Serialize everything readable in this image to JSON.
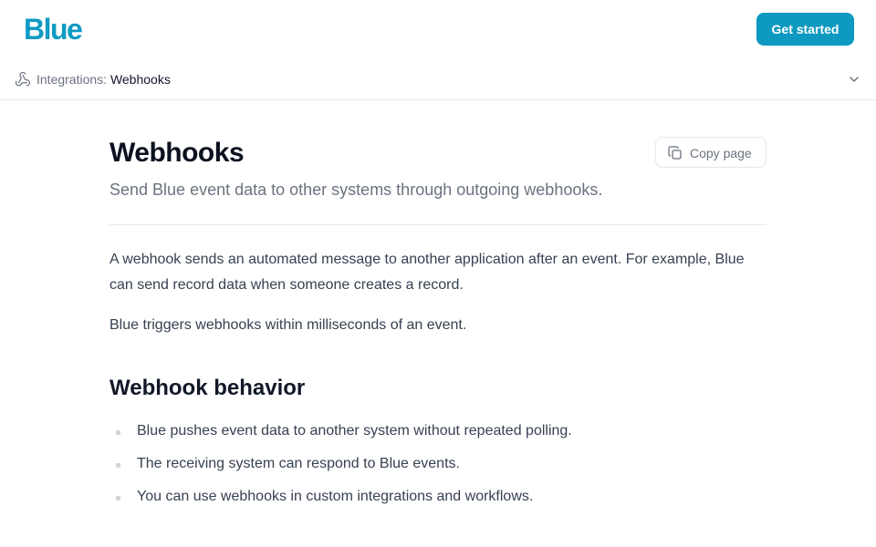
{
  "header": {
    "logo_text": "Blue",
    "cta_label": "Get started",
    "brand_color": "#0e99c0"
  },
  "breadcrumb": {
    "icon": "webhook-icon",
    "section": "Integrations: ",
    "current": "Webhooks",
    "toggle_icon": "chevron-down-icon"
  },
  "article": {
    "title": "Webhooks",
    "copy_button_label": "Copy page",
    "copy_icon": "copy-icon",
    "subtitle": "Send Blue event data to other systems through outgoing webhooks.",
    "paragraphs": [
      "A webhook sends an automated message to another application after an event. For example, Blue can send record data when someone creates a record.",
      "Blue triggers webhooks within milliseconds of an event."
    ],
    "section_heading": "Webhook behavior",
    "bullets": [
      "Blue pushes event data to another system without repeated polling.",
      "The receiving system can respond to Blue events.",
      "You can use webhooks in custom integrations and workflows."
    ]
  }
}
